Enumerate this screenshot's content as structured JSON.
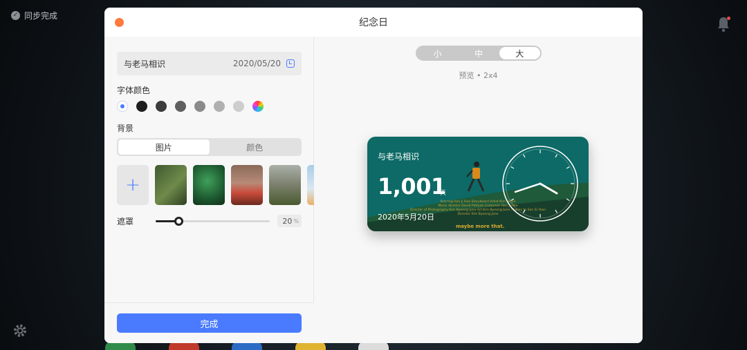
{
  "desktop": {
    "sync_status": "同步完成",
    "colors": {
      "notification_dot": "#e84a4a"
    }
  },
  "dialog": {
    "title": "纪念日",
    "colors": {
      "close_button": "#ff7a3c",
      "accent": "#4a7bff"
    }
  },
  "editor": {
    "name": "与老马相识",
    "date": "2020/05/20",
    "font_color_label": "字体颜色",
    "font_colors": [
      "#ffffff",
      "#1e1e1e",
      "#3c3c3c",
      "#5f5f5f",
      "#8a8a8a",
      "#b0b0b0",
      "#cdcdcd",
      "rainbow"
    ],
    "font_color_selected_index": 0,
    "background_label": "背景",
    "background_tabs": [
      {
        "label": "图片",
        "active": true
      },
      {
        "label": "颜色",
        "active": false
      }
    ],
    "add_image_symbol": "+",
    "mask_label": "遮罩",
    "mask_value": "20",
    "mask_unit": "%",
    "mask_fraction": 0.2,
    "done_label": "完成"
  },
  "preview": {
    "sizes": [
      {
        "label": "小",
        "active": false
      },
      {
        "label": "中",
        "active": false
      },
      {
        "label": "大",
        "active": true
      }
    ],
    "caption": "预览 • 2x4",
    "widget": {
      "title": "与老马相识",
      "count": "1,001",
      "count_unit": "天",
      "date": "2020年5月20日",
      "credits": [
        "Starring Han Ji Hee Storyboard Artist Kim Ha Jin",
        "Music director David Pettyan Costumer Han Ji Hee",
        "Director of Photography Kim Byeong June Art Kim Byeong June Thanks to Son Si Yeon",
        "Director Kim Byeong June"
      ],
      "tagline": "maybe more that."
    }
  }
}
